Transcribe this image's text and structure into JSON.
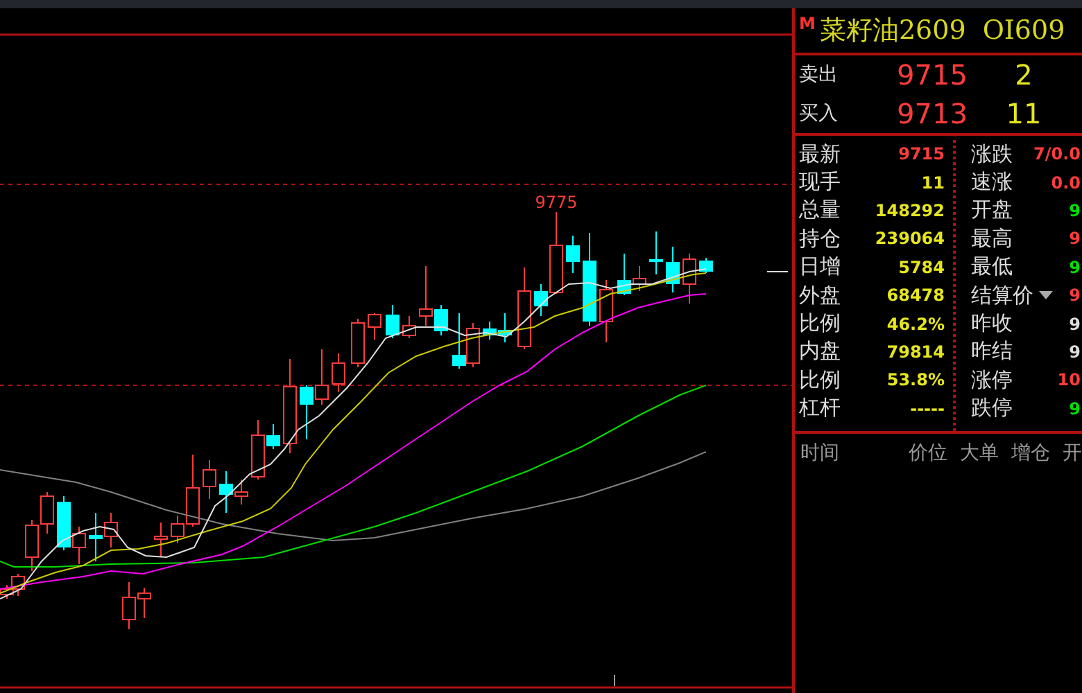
{
  "header": {
    "marker": "M",
    "title": "菜籽油2609",
    "code": "OI609"
  },
  "quotes": [
    {
      "label": "卖出",
      "price": "9715",
      "volume": "2"
    },
    {
      "label": "买入",
      "price": "9713",
      "volume": "11"
    }
  ],
  "stats_left": [
    {
      "label": "最新",
      "value": "9715",
      "color": "#ff3c3c"
    },
    {
      "label": "现手",
      "value": "11",
      "color": "#e6e61e"
    },
    {
      "label": "总量",
      "value": "148292",
      "color": "#e6e61e"
    },
    {
      "label": "持仓",
      "value": "239064",
      "color": "#e6e61e"
    },
    {
      "label": "日增",
      "value": "5784",
      "color": "#e6e61e"
    },
    {
      "label": "外盘",
      "value": "68478",
      "color": "#e6e61e"
    },
    {
      "label": "比例",
      "value": "46.2%",
      "color": "#e6e61e"
    },
    {
      "label": "内盘",
      "value": "79814",
      "color": "#e6e61e"
    },
    {
      "label": "比例",
      "value": "53.8%",
      "color": "#e6e61e"
    },
    {
      "label": "杠杆",
      "value": "-----",
      "color": "#e6e61e"
    }
  ],
  "stats_right": [
    {
      "label": "涨跌",
      "value": "7/0.0",
      "color": "#ff3c3c",
      "dropdown": false
    },
    {
      "label": "速涨",
      "value": "0.0",
      "color": "#ff3c3c",
      "dropdown": false
    },
    {
      "label": "开盘",
      "value": "9",
      "color": "#00e000",
      "dropdown": false
    },
    {
      "label": "最高",
      "value": "9",
      "color": "#ff3c3c",
      "dropdown": false
    },
    {
      "label": "最低",
      "value": "9",
      "color": "#00e000",
      "dropdown": false
    },
    {
      "label": "结算价",
      "value": "9",
      "color": "#ff3c3c",
      "dropdown": true
    },
    {
      "label": "昨收",
      "value": "9",
      "color": "#dddddd",
      "dropdown": false
    },
    {
      "label": "昨结",
      "value": "9",
      "color": "#dddddd",
      "dropdown": false
    },
    {
      "label": "涨停",
      "value": "10",
      "color": "#ff3c3c",
      "dropdown": false
    },
    {
      "label": "跌停",
      "value": "9",
      "color": "#00e000",
      "dropdown": false
    }
  ],
  "ticks_header": [
    "时间",
    "价位",
    "大单",
    "增仓",
    "开"
  ],
  "chart": {
    "high_label": "9775"
  }
}
